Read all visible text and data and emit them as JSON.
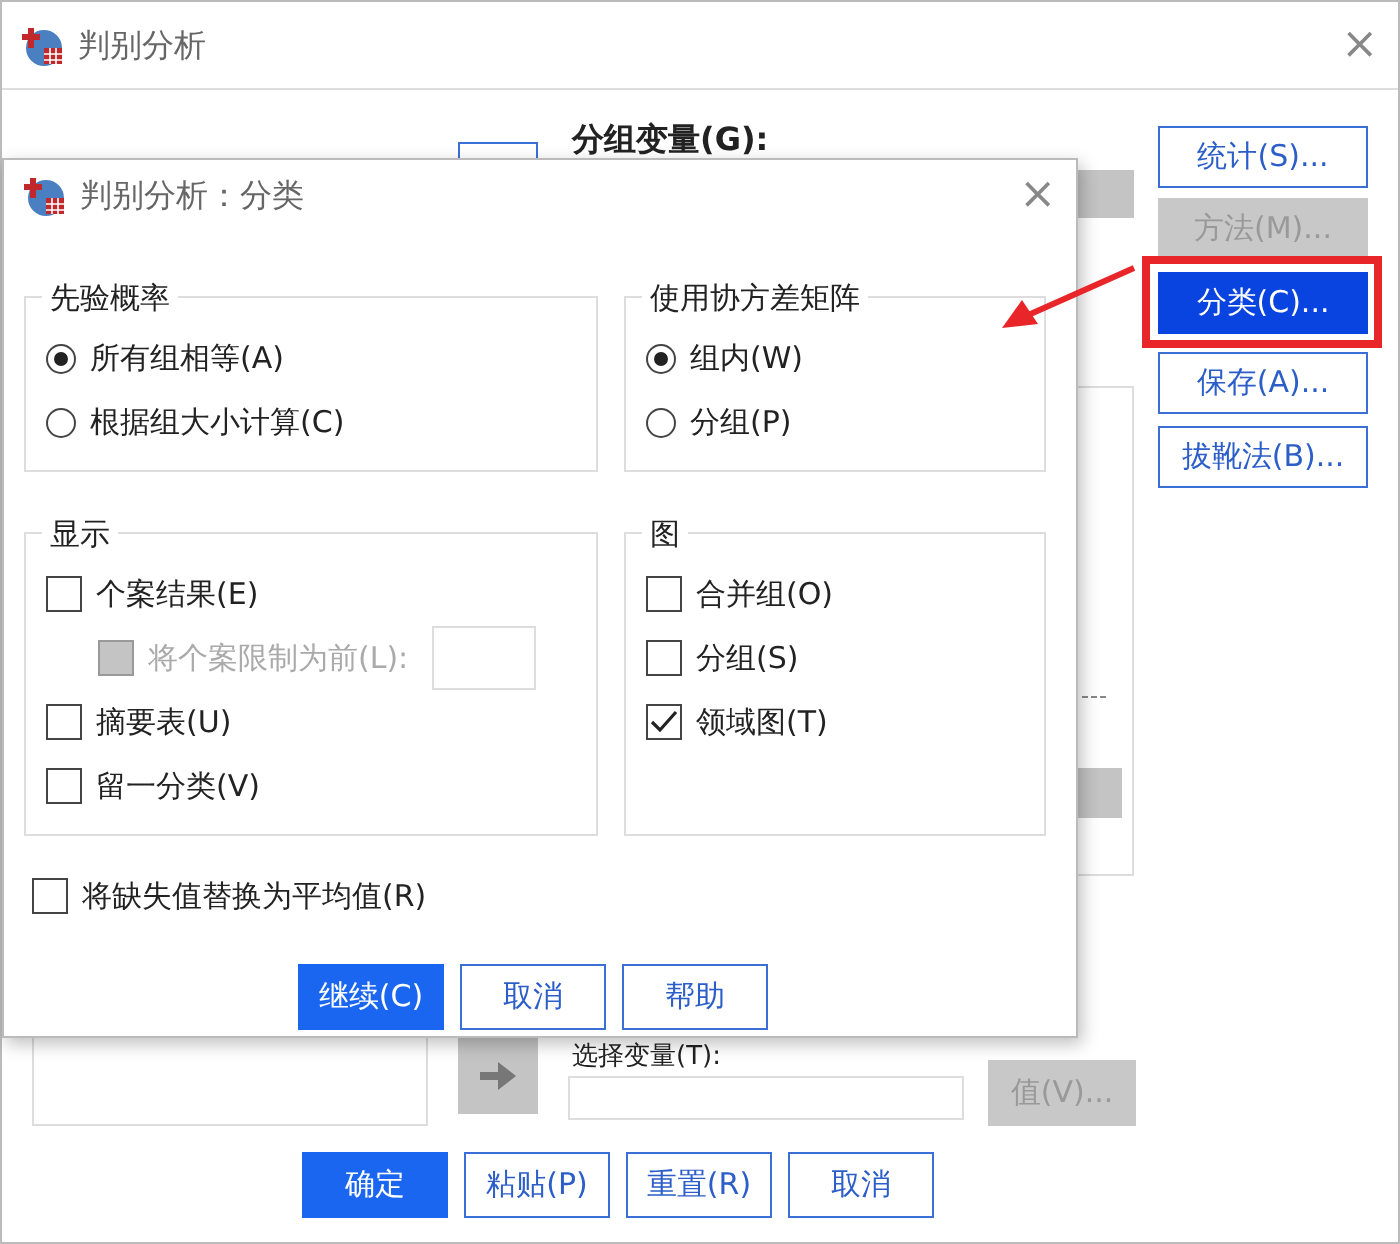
{
  "main_window": {
    "title": "判别分析",
    "close": "×",
    "grouping_label": "分组变量(G):",
    "side_buttons": [
      {
        "label": "统计(S)...",
        "disabled": false,
        "selected": false
      },
      {
        "label": "方法(M)...",
        "disabled": true,
        "selected": false
      },
      {
        "label": "分类(C)...",
        "disabled": false,
        "selected": true
      },
      {
        "label": "保存(A)...",
        "disabled": false,
        "selected": false
      },
      {
        "label": "拔靴法(B)...",
        "disabled": false,
        "selected": false
      }
    ],
    "selection_label": "选择变量(T):",
    "value_button": {
      "label": "值(V)...",
      "disabled": true
    },
    "footer_buttons": [
      {
        "label": "确定",
        "default": true
      },
      {
        "label": "粘贴(P)",
        "default": false
      },
      {
        "label": "重置(R)",
        "default": false
      },
      {
        "label": "取消",
        "default": false
      }
    ]
  },
  "dialog": {
    "title": "判别分析：分类",
    "close": "×",
    "prior": {
      "title": "先验概率",
      "options": [
        {
          "label": "所有组相等(A)",
          "selected": true
        },
        {
          "label": "根据组大小计算(C)",
          "selected": false
        }
      ]
    },
    "covariance": {
      "title": "使用协方差矩阵",
      "options": [
        {
          "label": "组内(W)",
          "selected": true
        },
        {
          "label": "分组(P)",
          "selected": false
        }
      ]
    },
    "display": {
      "title": "显示",
      "items": [
        {
          "label": "个案结果(E)",
          "checked": false,
          "disabled": false,
          "children": [
            {
              "label": "将个案限制为前(L):",
              "checked": false,
              "disabled": true
            }
          ]
        },
        {
          "label": "摘要表(U)",
          "checked": false,
          "disabled": false
        },
        {
          "label": "留一分类(V)",
          "checked": false,
          "disabled": false
        }
      ]
    },
    "plots": {
      "title": "图",
      "items": [
        {
          "label": "合并组(O)",
          "checked": false,
          "disabled": false
        },
        {
          "label": "分组(S)",
          "checked": false,
          "disabled": false
        },
        {
          "label": "领域图(T)",
          "checked": true,
          "disabled": false
        }
      ]
    },
    "replace_missing": {
      "label": "将缺失值替换为平均值(R)",
      "checked": false
    },
    "buttons": [
      {
        "label": "继续(C)",
        "default": true
      },
      {
        "label": "取消",
        "default": false
      },
      {
        "label": "帮助",
        "default": false
      }
    ]
  }
}
